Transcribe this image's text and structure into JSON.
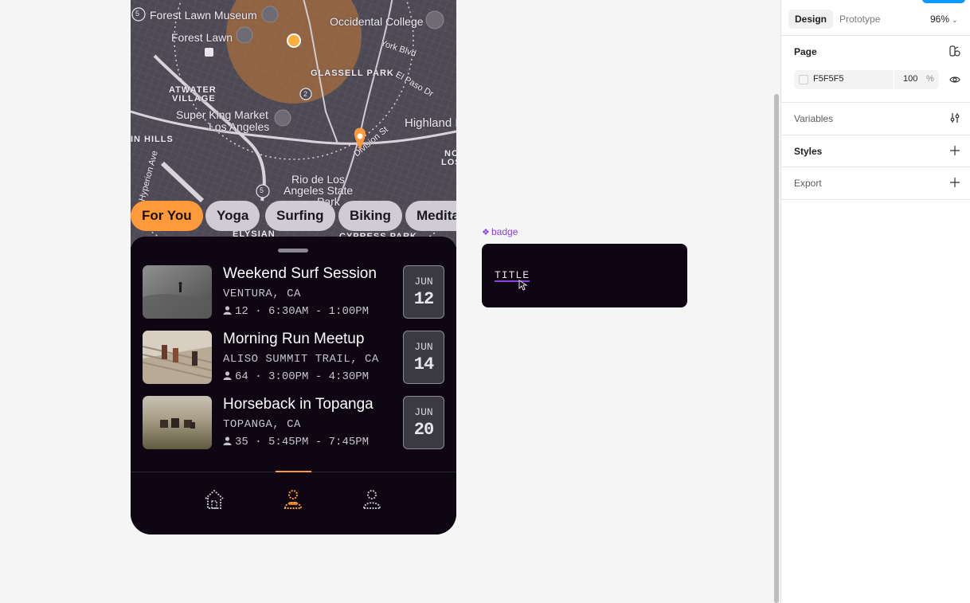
{
  "map": {
    "labels": [
      "Forest Lawn Museum",
      "Forest Lawn",
      "Occidental College",
      "York Blvd",
      "GLASSELL PARK",
      "El Paso Dr",
      "ATWATER",
      "VILLAGE",
      "Super King Market",
      "Los Angeles",
      "Highland P",
      "IN HILLS",
      "Division St",
      "NO",
      "LOS",
      "Hyperion Ave",
      "Rio de Los",
      "Angeles State",
      "Park",
      "ELYSIAN",
      "CYPRESS PARK"
    ],
    "route_shields": [
      "5",
      "2",
      "5"
    ]
  },
  "chips": [
    "For You",
    "Yoga",
    "Surfing",
    "Biking",
    "Medita"
  ],
  "events": [
    {
      "title": "Weekend Surf Session",
      "location": "VENTURA, CA",
      "attendees": "12",
      "time": "6:30AM - 1:00PM",
      "month": "JUN",
      "day": "12"
    },
    {
      "title": "Morning Run Meetup",
      "location": "ALISO SUMMIT TRAIL, CA",
      "attendees": "64",
      "time": "3:00PM - 4:30PM",
      "month": "JUN",
      "day": "14"
    },
    {
      "title": "Horseback in Topanga",
      "location": "TOPANGA, CA",
      "attendees": "35",
      "time": "5:45PM - 7:45PM",
      "month": "JUN",
      "day": "20"
    }
  ],
  "nav": {
    "items": [
      "home-icon",
      "events-icon",
      "profile-icon"
    ],
    "active_index": 1
  },
  "component": {
    "label": "badge",
    "text": "TITLE"
  },
  "panel": {
    "tabs": [
      "Design",
      "Prototype"
    ],
    "zoom": "96%",
    "page_title": "Page",
    "page_color": "F5F5F5",
    "page_opacity": "100",
    "page_opacity_unit": "%",
    "variables": "Variables",
    "styles": "Styles",
    "export": "Export"
  },
  "colors": {
    "accent": "#ff9a3c",
    "phone_bg": "#0e0612",
    "component_purple": "#8a3fe0",
    "figma_blue": "#0d99ff"
  }
}
